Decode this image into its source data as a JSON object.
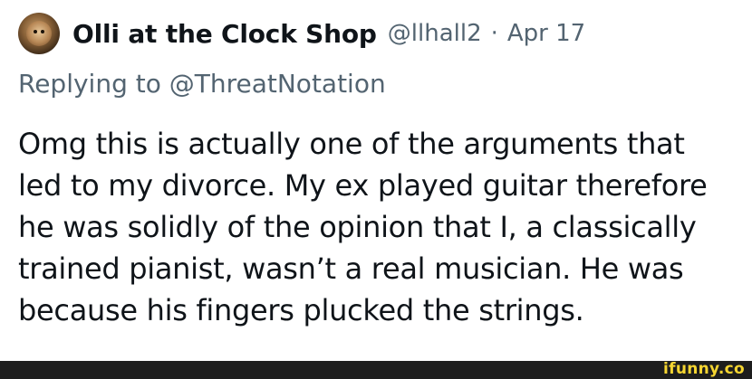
{
  "tweet": {
    "author": {
      "display_name": "Olli at the Clock Shop",
      "handle": "@llhall2",
      "separator": "·",
      "date": "Apr 17"
    },
    "reply": {
      "text": "Replying to @ThreatNotation"
    },
    "body_lines": [
      "Omg this is actually one of the arguments that",
      "led to my divorce. My ex played guitar therefore",
      "he was solidly of the opinion that I, a classically",
      "trained pianist, wasn’t a real musician. He was",
      "because his fingers plucked the strings."
    ]
  },
  "footer": {
    "watermark": "ifunny.co"
  }
}
